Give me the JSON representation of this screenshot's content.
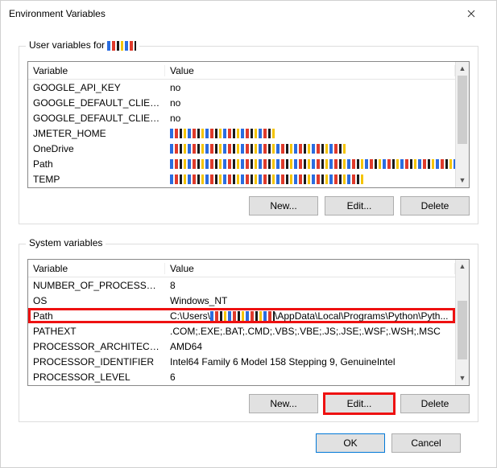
{
  "window": {
    "title": "Environment Variables"
  },
  "user_section": {
    "legend_prefix": "User variables for ",
    "header": {
      "variable": "Variable",
      "value": "Value"
    },
    "rows": [
      {
        "var": "GOOGLE_API_KEY",
        "val": "no"
      },
      {
        "var": "GOOGLE_DEFAULT_CLIENT_ID",
        "val": "no"
      },
      {
        "var": "GOOGLE_DEFAULT_CLIENT_...",
        "val": "no"
      },
      {
        "var": "JMETER_HOME",
        "val": "",
        "mosaic_w": 130
      },
      {
        "var": "OneDrive",
        "val": "",
        "mosaic_w": 220
      },
      {
        "var": "Path",
        "val": "",
        "mosaic_w": 360
      },
      {
        "var": "TEMP",
        "val": "",
        "mosaic_w": 240
      }
    ],
    "buttons": {
      "new": "New...",
      "edit": "Edit...",
      "delete": "Delete"
    }
  },
  "system_section": {
    "legend": "System variables",
    "header": {
      "variable": "Variable",
      "value": "Value"
    },
    "rows": [
      {
        "var": "NUMBER_OF_PROCESSORS",
        "val": "8"
      },
      {
        "var": "OS",
        "val": "Windows_NT"
      },
      {
        "var": "Path",
        "val_prefix": "C:\\Users\\",
        "val_suffix": "\\AppData\\Local\\Programs\\Python\\Pyth...",
        "highlight": true,
        "mosaic_w": 80
      },
      {
        "var": "PATHEXT",
        "val": ".COM;.EXE;.BAT;.CMD;.VBS;.VBE;.JS;.JSE;.WSF;.WSH;.MSC"
      },
      {
        "var": "PROCESSOR_ARCHITECTURE",
        "val": "AMD64"
      },
      {
        "var": "PROCESSOR_IDENTIFIER",
        "val": "Intel64 Family 6 Model 158 Stepping 9, GenuineIntel"
      },
      {
        "var": "PROCESSOR_LEVEL",
        "val": "6"
      }
    ],
    "buttons": {
      "new": "New...",
      "edit": "Edit...",
      "delete": "Delete"
    }
  },
  "dialog_buttons": {
    "ok": "OK",
    "cancel": "Cancel"
  }
}
